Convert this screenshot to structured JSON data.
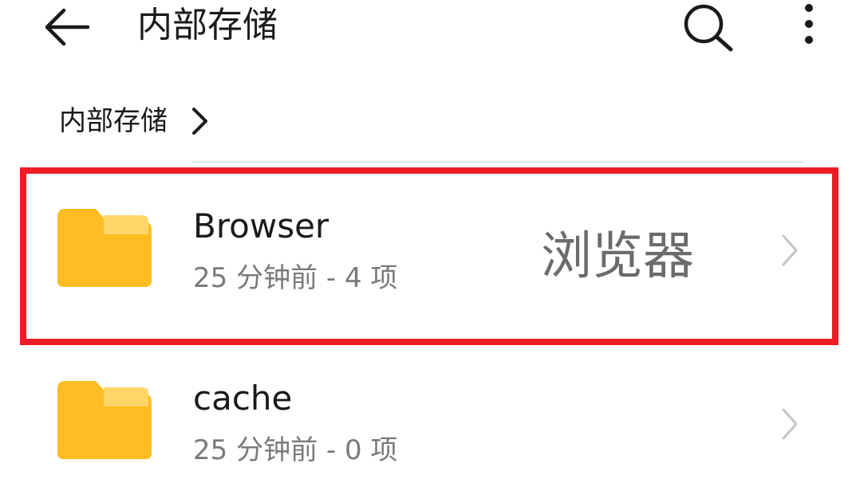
{
  "header": {
    "title": "内部存储",
    "back_icon": "arrow-left-icon",
    "search_icon": "search-icon",
    "more_icon": "more-vertical-icon"
  },
  "breadcrumb": {
    "label": "内部存储",
    "chevron_icon": "chevron-right-icon"
  },
  "files": [
    {
      "name": "Browser",
      "meta": "25 分钟前 - 4 项",
      "icon": "folder-icon",
      "annotation": "浏览器",
      "highlighted": true
    },
    {
      "name": "cache",
      "meta": "25 分钟前 - 0 项",
      "icon": "folder-icon",
      "highlighted": false
    }
  ],
  "colors": {
    "folder": "#ffbd23",
    "folder_tab": "#ffd668",
    "highlight": "#ee1c25",
    "annotation": "#6b6b6b",
    "chevron": "#c4c4c4",
    "meta_text": "#7a7a7a"
  }
}
